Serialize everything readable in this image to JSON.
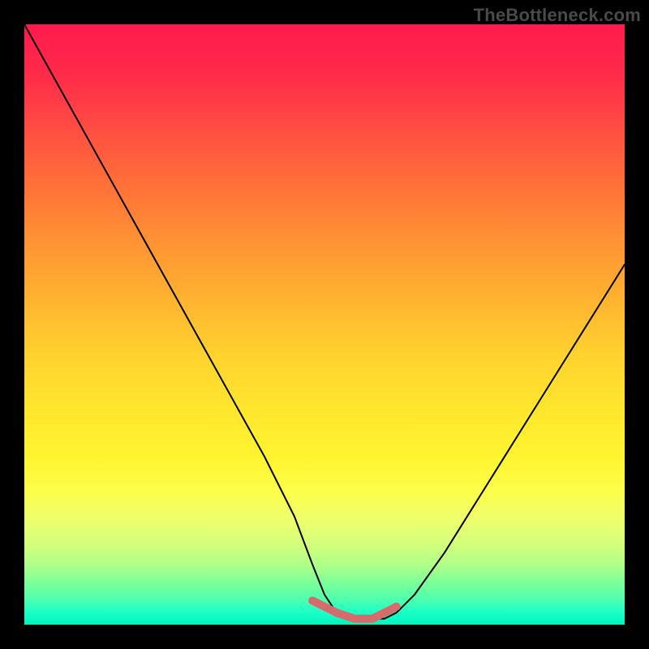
{
  "watermark": "TheBottleneck.com",
  "chart_data": {
    "type": "line",
    "title": "",
    "xlabel": "",
    "ylabel": "",
    "xlim": [
      0,
      100
    ],
    "ylim": [
      0,
      100
    ],
    "x": [
      0,
      5,
      10,
      15,
      20,
      25,
      30,
      35,
      40,
      45,
      48,
      50,
      52,
      55,
      58,
      60,
      62,
      65,
      70,
      75,
      80,
      85,
      90,
      95,
      100
    ],
    "values": [
      100,
      91,
      82,
      73,
      64,
      55,
      46,
      37,
      28,
      18,
      10,
      5,
      2,
      1,
      1,
      1,
      2,
      5,
      12,
      20,
      28,
      36,
      44,
      52,
      60
    ],
    "highlight": {
      "x": [
        48,
        50,
        52,
        55,
        58,
        60,
        62
      ],
      "values": [
        4,
        3,
        2,
        1,
        1,
        2,
        3
      ]
    },
    "colors": {
      "gradient_top": "#ff1a4d",
      "gradient_bottom": "#00f5bb",
      "curve": "#000000",
      "highlight": "#d76a6a",
      "frame": "#000000"
    }
  }
}
